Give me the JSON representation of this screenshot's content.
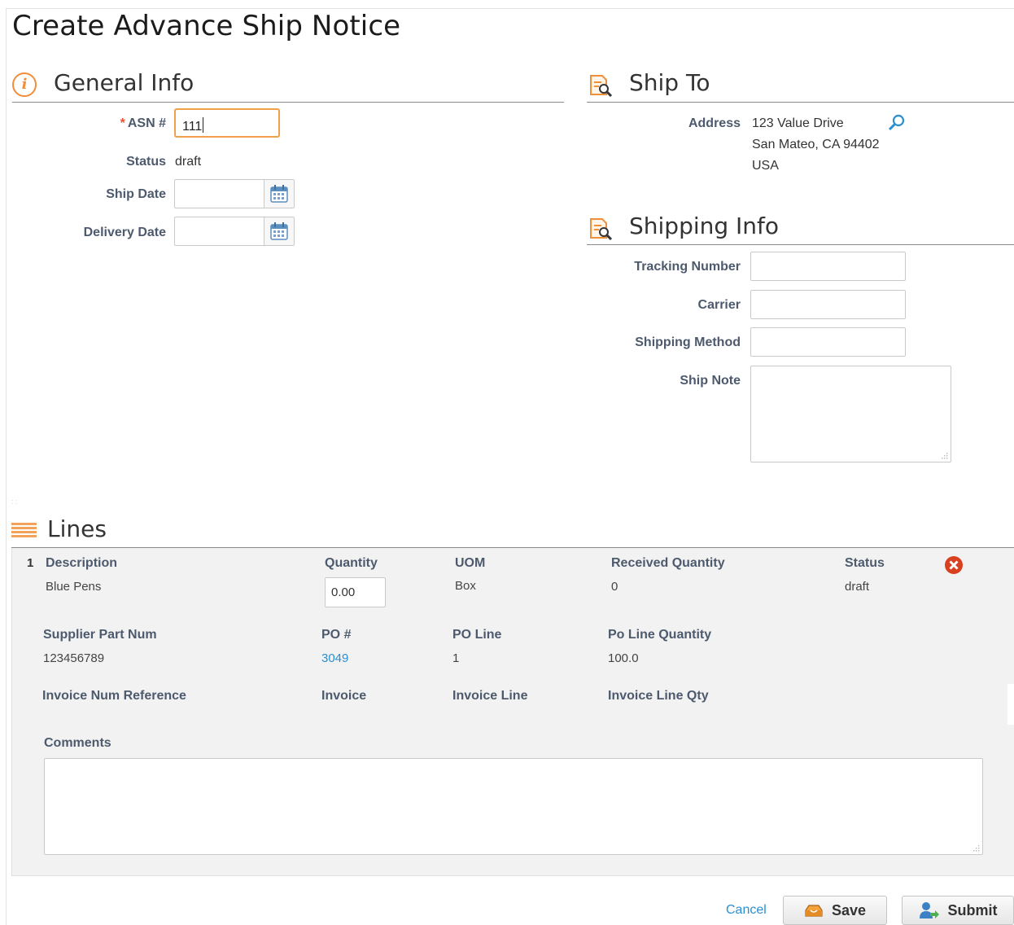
{
  "page": {
    "title": "Create Advance Ship Notice"
  },
  "general_info": {
    "title": "General Info",
    "asn_label": "ASN #",
    "asn_required_mark": "*",
    "asn_value": "111",
    "status_label": "Status",
    "status_value": "draft",
    "ship_date_label": "Ship Date",
    "delivery_date_label": "Delivery Date"
  },
  "ship_to": {
    "title": "Ship To",
    "address_label": "Address",
    "address_line1": "123 Value Drive",
    "address_line2": "San Mateo, CA 94402",
    "address_line3": "USA"
  },
  "shipping_info": {
    "title": "Shipping Info",
    "tracking_label": "Tracking Number",
    "carrier_label": "Carrier",
    "method_label": "Shipping Method",
    "note_label": "Ship Note"
  },
  "lines": {
    "title": "Lines",
    "items": [
      {
        "number": "1",
        "description_label": "Description",
        "description": "Blue Pens",
        "quantity_label": "Quantity",
        "quantity": "0.00",
        "uom_label": "UOM",
        "uom": "Box",
        "received_label": "Received Quantity",
        "received": "0",
        "status_label": "Status",
        "status": "draft",
        "supplier_part_label": "Supplier Part Num",
        "supplier_part": "123456789",
        "po_label": "PO #",
        "po": "3049",
        "po_line_label": "PO Line",
        "po_line": "1",
        "po_line_qty_label": "Po Line Quantity",
        "po_line_qty": "100.0",
        "invoice_ref_label": "Invoice Num Reference",
        "invoice_label": "Invoice",
        "invoice_line_label": "Invoice Line",
        "invoice_line_qty_label": "Invoice Line Qty",
        "comments_label": "Comments"
      }
    ]
  },
  "actions": {
    "cancel": "Cancel",
    "save": "Save",
    "submit": "Submit"
  },
  "colors": {
    "accent_orange": "#f08e3a",
    "link_blue": "#2a8fd0",
    "delete_red": "#d9401f",
    "label": "#4d5a6d"
  }
}
